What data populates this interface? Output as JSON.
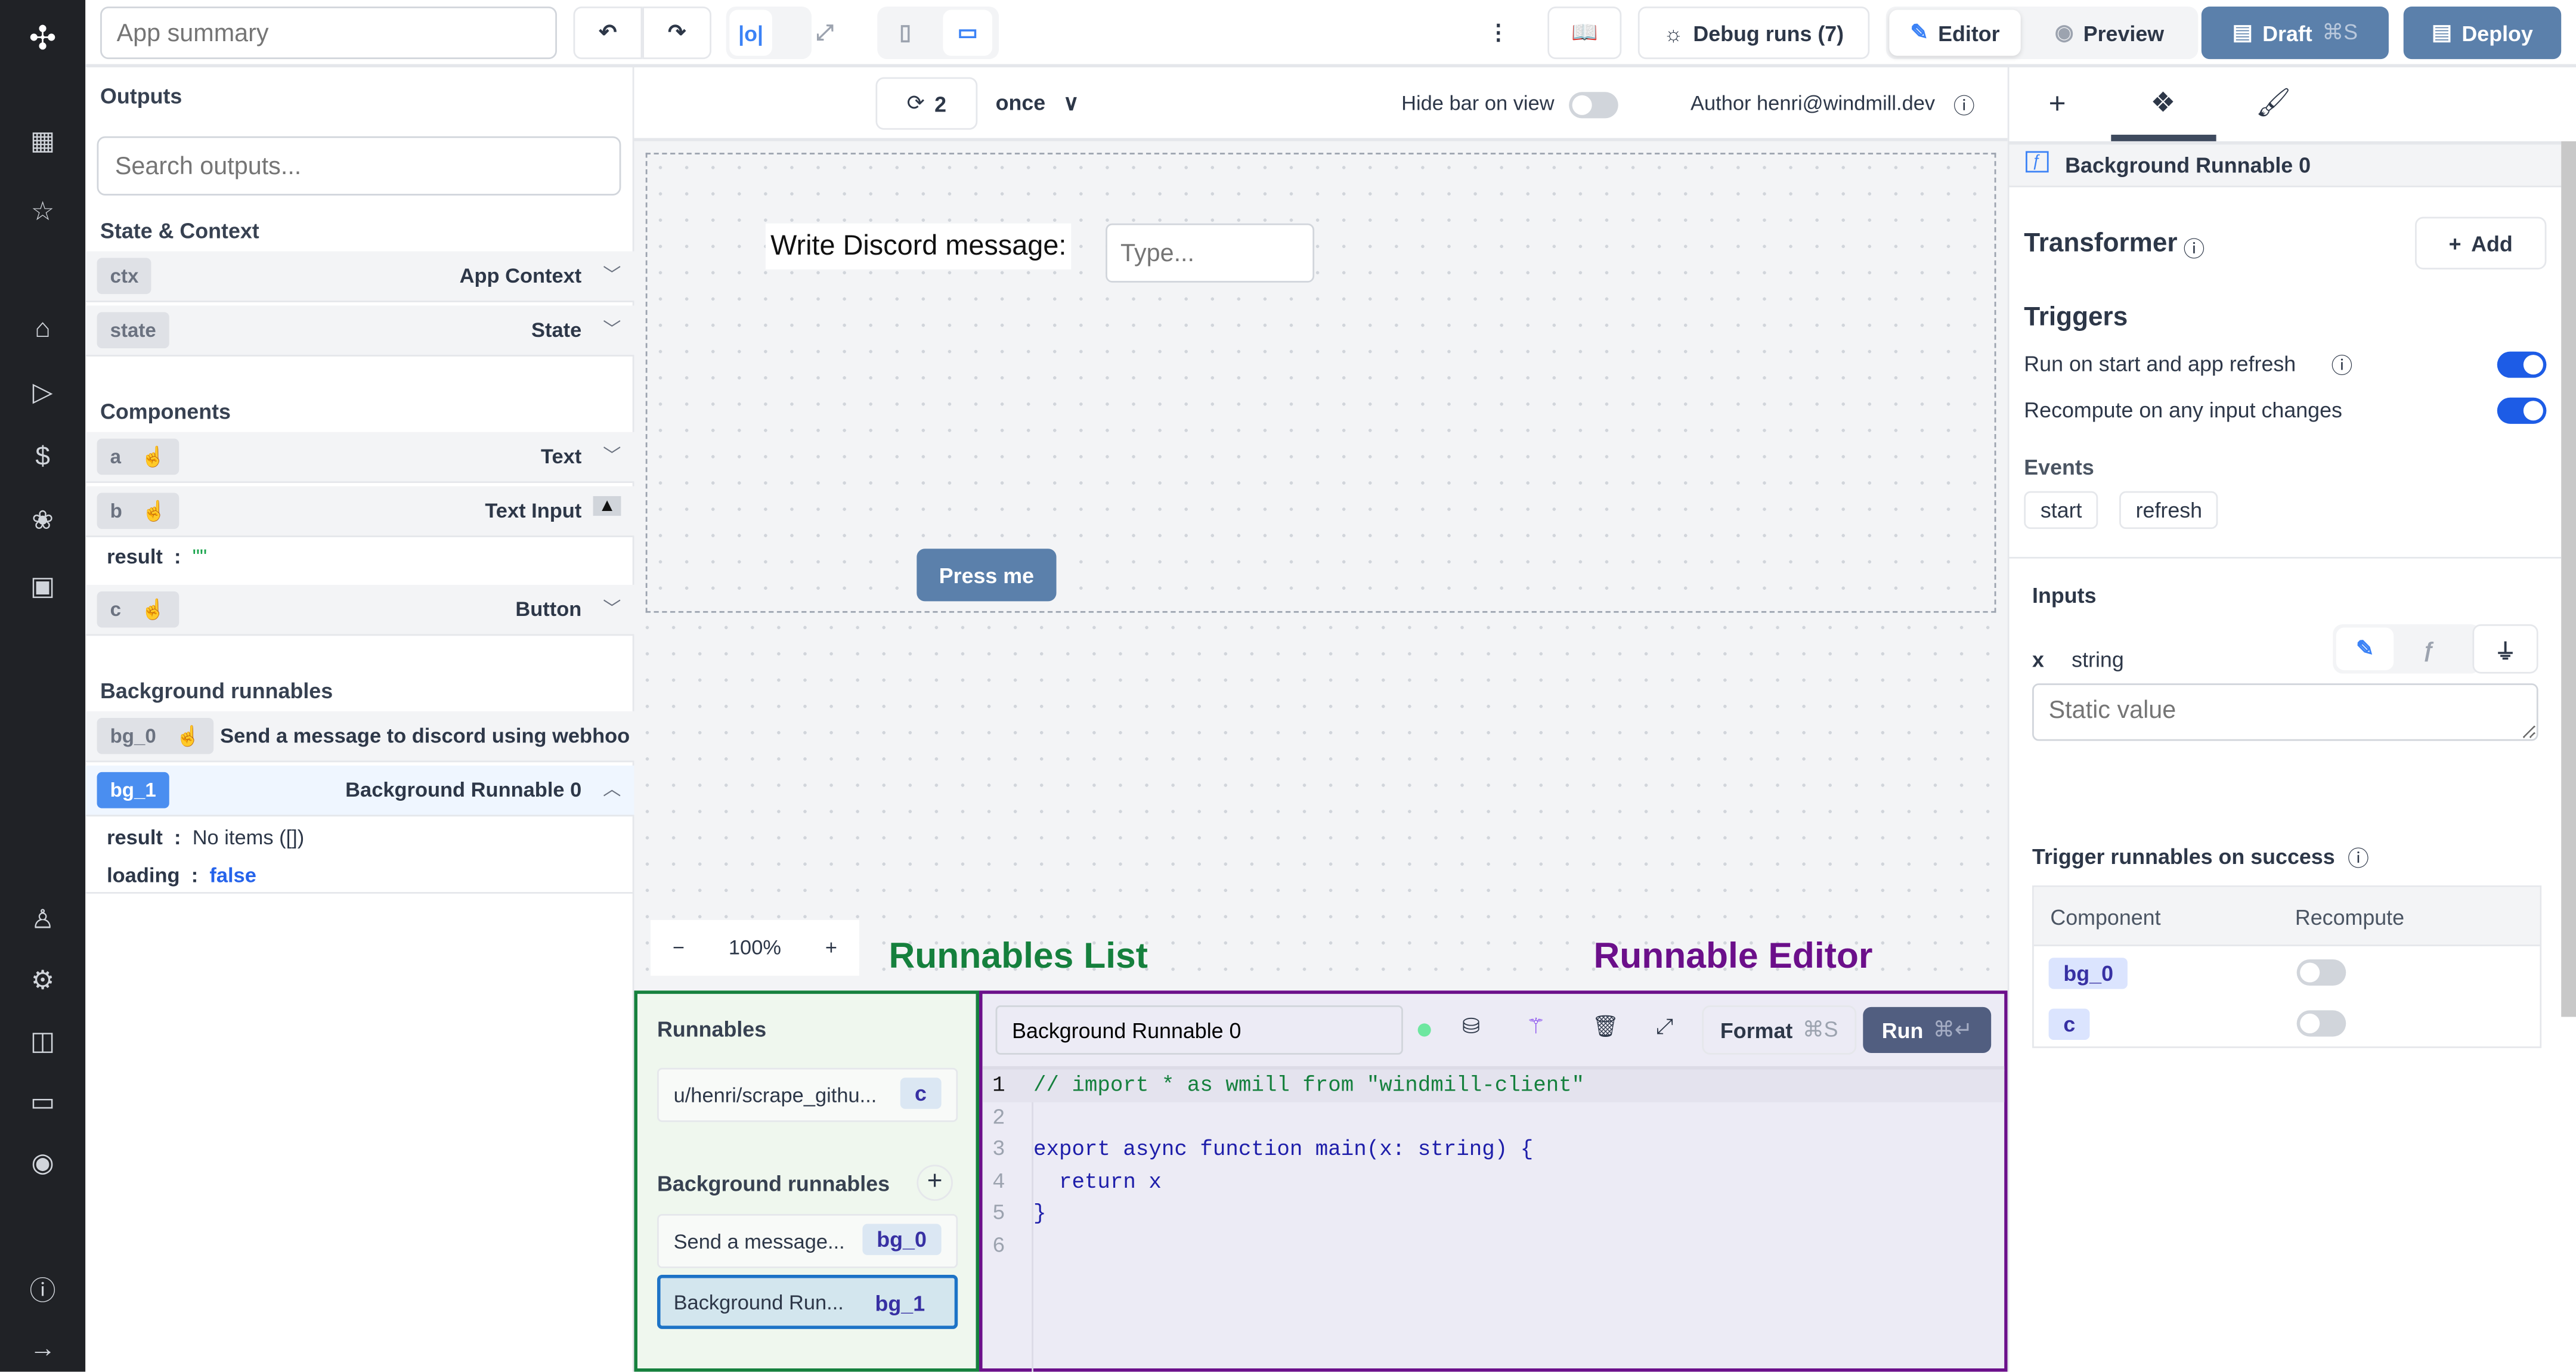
{
  "topbar": {
    "app_summary_placeholder": "App summary",
    "debug_runs": "Debug runs (7)",
    "editor": "Editor",
    "preview": "Preview",
    "draft": "Draft",
    "draft_shortcut": "⌘S",
    "deploy": "Deploy"
  },
  "subbar": {
    "refresh_count": "2",
    "refresh_mode": "once",
    "hide_bar": "Hide bar on view",
    "author": "Author henri@windmill.dev"
  },
  "outputs": {
    "title": "Outputs",
    "search_placeholder": "Search outputs...",
    "state_context": "State & Context",
    "state_rows": [
      {
        "id": "ctx",
        "label": "App Context"
      },
      {
        "id": "state",
        "label": "State"
      }
    ],
    "components_title": "Components",
    "components": [
      {
        "id": "a",
        "label": "Text"
      },
      {
        "id": "b",
        "label": "Text Input",
        "result_key": "result",
        "result_value": "\"\""
      },
      {
        "id": "c",
        "label": "Button"
      }
    ],
    "bg_title": "Background runnables",
    "bg": [
      {
        "id": "bg_0",
        "label": "Send a message to discord using webhoo"
      },
      {
        "id": "bg_1",
        "label": "Background Runnable 0",
        "result_key": "result",
        "result_value": "No items ([])",
        "loading_key": "loading",
        "loading_value": "false"
      }
    ]
  },
  "canvas": {
    "text_label": "Write Discord message:",
    "input_placeholder": "Type...",
    "button": "Press me",
    "zoom": "100%"
  },
  "annotations": {
    "runnables_list": "Runnables List",
    "runnable_editor": "Runnable Editor",
    "list_color": "#15803d",
    "editor_color": "#6b0f8a"
  },
  "runnables": {
    "title": "Runnables",
    "items": [
      {
        "name": "u/henri/scrape_githu...",
        "id": "c"
      }
    ],
    "bg_title": "Background runnables",
    "bg_items": [
      {
        "name": "Send a message...",
        "id": "bg_0"
      },
      {
        "name": "Background Run...",
        "id": "bg_1"
      }
    ]
  },
  "editor": {
    "name": "Background Runnable 0",
    "format": "Format",
    "format_shortcut": "⌘S",
    "run": "Run",
    "run_shortcut": "⌘↵",
    "lines": [
      "// import * as wmill from \"windmill-client\"",
      "",
      "export async function main(x: string) {",
      "  return x",
      "}",
      ""
    ]
  },
  "panel": {
    "title": "Background Runnable 0",
    "transformer": "Transformer",
    "add": "Add",
    "triggers": "Triggers",
    "run_on_start": "Run on start and app refresh",
    "run_on_start_on": true,
    "recompute": "Recompute on any input changes",
    "recompute_on": true,
    "events": "Events",
    "event_tags": [
      "start",
      "refresh"
    ],
    "inputs": "Inputs",
    "input_name": "x",
    "input_type": "string",
    "static_placeholder": "Static value",
    "trigger_success": "Trigger runnables on success",
    "table_headers": [
      "Component",
      "Recompute"
    ],
    "table_rows": [
      {
        "id": "bg_0",
        "recompute": false
      },
      {
        "id": "c",
        "recompute": false
      }
    ]
  }
}
